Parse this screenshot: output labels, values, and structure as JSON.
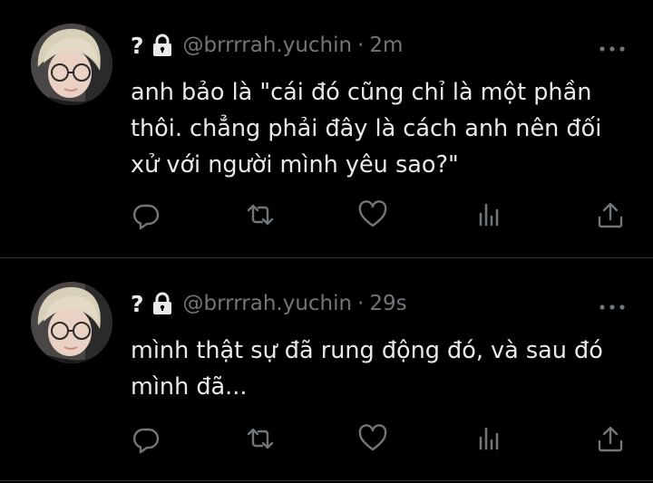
{
  "theme": {
    "background": "#000000",
    "text": "#e7e9ea",
    "secondary": "#71767b",
    "divider": "#2f3336"
  },
  "tweets": [
    {
      "display_name": "?",
      "handle": "@brrrrah.yuchin",
      "separator": "·",
      "time": "2m",
      "protected_icon": "lock-icon",
      "text": "anh bảo là \"cái đó cũng chỉ là một phần\nthôi. chẳng phải đây là cách anh nên đối\nxử với người mình yêu sao?\"",
      "actions": [
        "reply-icon",
        "retweet-icon",
        "like-icon",
        "views-icon",
        "share-icon"
      ]
    },
    {
      "display_name": "?",
      "handle": "@brrrrah.yuchin",
      "separator": "·",
      "time": "29s",
      "protected_icon": "lock-icon",
      "text": "mình thật sự đã rung động đó, và sau đó\nmình đã...",
      "actions": [
        "reply-icon",
        "retweet-icon",
        "like-icon",
        "views-icon",
        "share-icon"
      ]
    }
  ]
}
